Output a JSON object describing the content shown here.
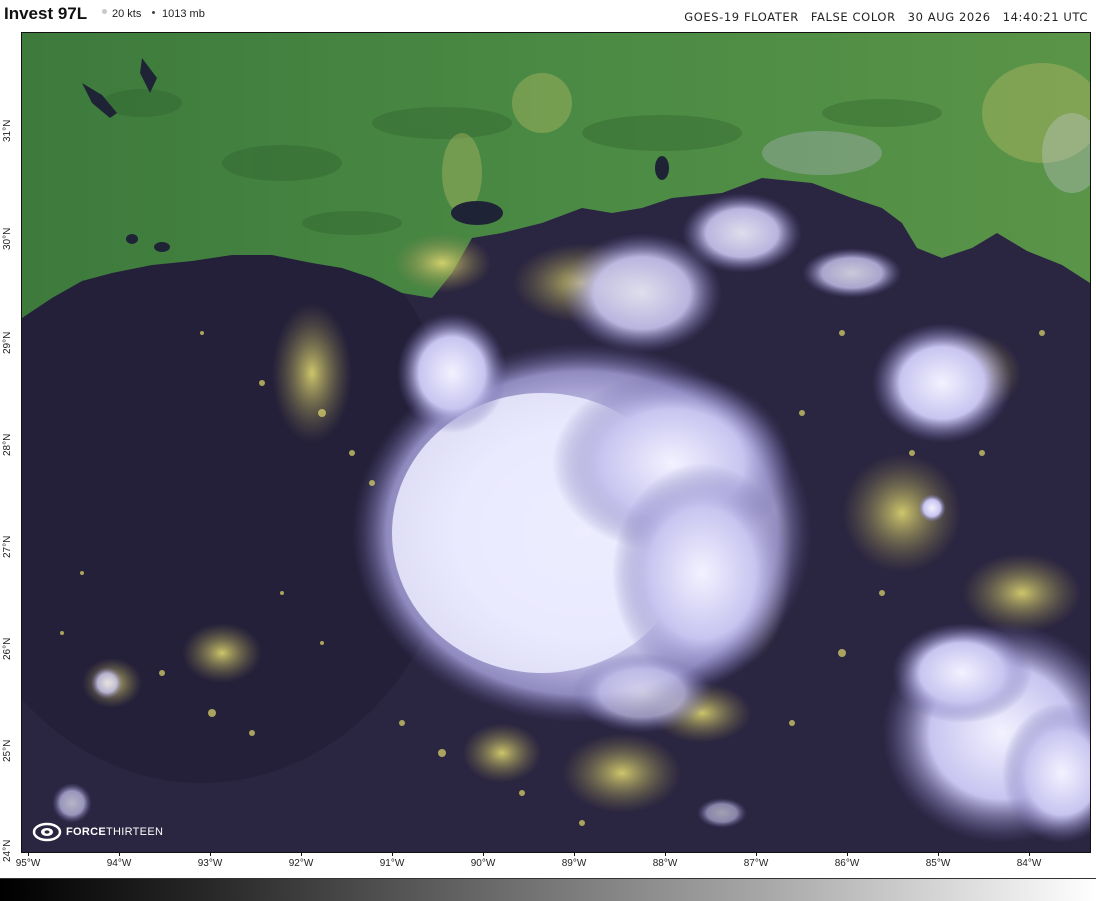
{
  "header": {
    "storm_name": "Invest 97L",
    "wind": "20 kts",
    "pressure": "1013 mb",
    "satellite": "GOES-19 FLOATER",
    "product": "FALSE COLOR",
    "date": "30 AUG 2026",
    "time": "14:40:21 UTC"
  },
  "lat_labels": [
    "31°N",
    "30°N",
    "29°N",
    "28°N",
    "27°N",
    "26°N",
    "25°N",
    "24°N"
  ],
  "lon_labels": [
    "95°W",
    "94°W",
    "93°W",
    "92°W",
    "91°W",
    "90°W",
    "89°W",
    "88°W",
    "87°W",
    "86°W",
    "85°W",
    "84°W"
  ],
  "logo": {
    "bold": "FORCE",
    "thin": "THIRTEEN",
    "icon": "force-thirteen-swirl-icon"
  },
  "colors": {
    "land": "#3f7a3a",
    "water": "#2a2540",
    "cloud": "#e8e6fb",
    "low_cloud": "#d8d06a"
  },
  "colorbar": {
    "type": "grayscale",
    "from": "#000000",
    "to": "#ffffff"
  }
}
